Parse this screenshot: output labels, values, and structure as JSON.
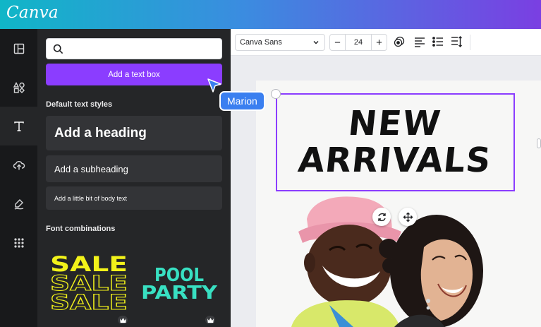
{
  "app": {
    "logo": "Canva"
  },
  "rail": {
    "items": [
      {
        "name": "templates",
        "icon": "layout-icon"
      },
      {
        "name": "elements",
        "icon": "shapes-icon"
      },
      {
        "name": "text",
        "icon": "text-icon",
        "active": true
      },
      {
        "name": "uploads",
        "icon": "cloud-upload-icon"
      },
      {
        "name": "draw",
        "icon": "draw-icon"
      },
      {
        "name": "apps",
        "icon": "apps-grid-icon"
      }
    ]
  },
  "panel": {
    "search": {
      "value": "",
      "placeholder": ""
    },
    "add_text_box_label": "Add a text box",
    "default_styles_title": "Default text styles",
    "heading_label": "Add a heading",
    "subheading_label": "Add a subheading",
    "body_label": "Add a little bit of body text",
    "font_combos_title": "Font combinations",
    "combos": [
      {
        "lines": [
          "SALE",
          "SALE",
          "SALE"
        ],
        "color": "#f2f21a",
        "premium": true
      },
      {
        "lines": [
          "POOL",
          "PARTY"
        ],
        "color": "#38e0c2",
        "premium": true
      }
    ]
  },
  "toolbar": {
    "font_family": "Canva Sans",
    "font_size": "24",
    "minus_label": "−",
    "plus_label": "+"
  },
  "canvas": {
    "headline_line1": "NEW",
    "headline_line2": "ARRIVALS"
  },
  "collaborator": {
    "name": "Marion",
    "color": "#3a7ff0"
  },
  "colors": {
    "accent": "#8b3dff",
    "panel": "#252628",
    "rail": "#18191b"
  }
}
